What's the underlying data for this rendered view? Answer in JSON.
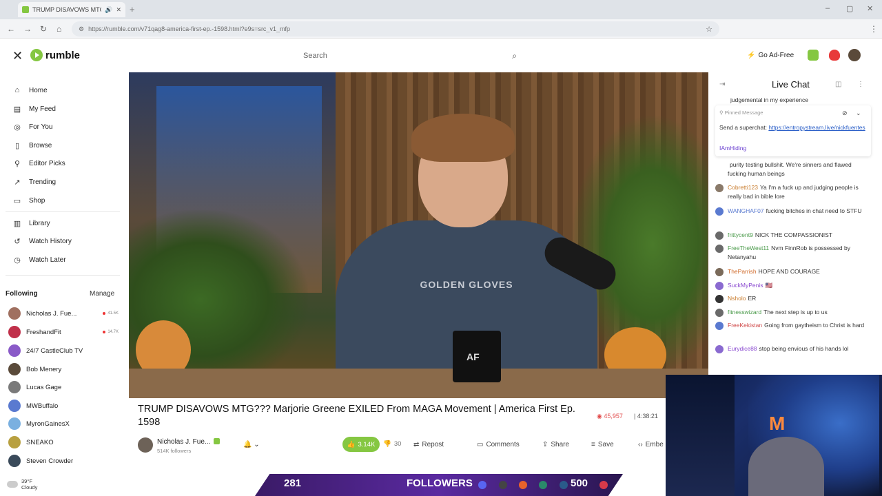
{
  "browser": {
    "tab_title": "TRUMP DISAVOWS MTG???",
    "url": "https://rumble.com/v71qag8-america-first-ep.-1598.html?e9s=src_v1_mfp",
    "profile_letter": "T"
  },
  "header": {
    "logo": "rumble",
    "search_placeholder": "Search",
    "go_ad_free": "Go Ad-Free"
  },
  "sidebar": {
    "items": [
      {
        "label": "Home",
        "icon": "home-icon"
      },
      {
        "label": "My Feed",
        "icon": "feed-icon"
      },
      {
        "label": "For You",
        "icon": "target-icon"
      },
      {
        "label": "Browse",
        "icon": "browse-icon"
      },
      {
        "label": "Editor Picks",
        "icon": "editor-picks-icon"
      },
      {
        "label": "Trending",
        "icon": "trending-icon"
      },
      {
        "label": "Shop",
        "icon": "shop-icon"
      },
      {
        "label": "Library",
        "icon": "library-icon"
      },
      {
        "label": "Watch History",
        "icon": "history-icon"
      },
      {
        "label": "Watch Later",
        "icon": "clock-icon"
      }
    ],
    "following_title": "Following",
    "manage": "Manage",
    "following": [
      {
        "name": "Nicholas J. Fue...",
        "live": "41.5K",
        "color": "#a07060"
      },
      {
        "name": "FreshandFit",
        "live": "14.7K",
        "color": "#c0304a"
      },
      {
        "name": "24/7 CastleClub TV",
        "live": "",
        "color": "#8a5ac8"
      },
      {
        "name": "Bob Menery",
        "live": "",
        "color": "#5a4a3a"
      },
      {
        "name": "Lucas Gage",
        "live": "",
        "color": "#7a7a7a"
      },
      {
        "name": "MWBuffalo",
        "live": "",
        "color": "#5a7ad0"
      },
      {
        "name": "MyronGainesX",
        "live": "",
        "color": "#7ab0e0"
      },
      {
        "name": "SNEAKO",
        "live": "",
        "color": "#b8a040"
      },
      {
        "name": "Steven Crowder",
        "live": "",
        "color": "#3a4a5a"
      }
    ]
  },
  "video": {
    "hoodie": "GOLDEN GLOVES",
    "mug": "AF",
    "title": "TRUMP DISAVOWS MTG??? Marjorie Greene EXILED From MAGA Movement | America First Ep. 1598",
    "views": "45,957",
    "duration": "| 4:38:21",
    "channel": "Nicholas J. Fue...",
    "followers": "514K followers",
    "likes": "3.14K",
    "dislikes": "30",
    "repost": "Repost",
    "comments": "Comments",
    "share": "Share",
    "save": "Save",
    "embed": "Embe"
  },
  "chat": {
    "title": "Live Chat",
    "cut_line": "judgemental in my experience",
    "pinned_label": "Pinned Message",
    "pinned_text": "Send a superchat: ",
    "pinned_link": "https://entropystream.live/nickfuentes",
    "pinned_user": "IAmHiding",
    "messages": [
      {
        "user": "",
        "text": "purity testing bullshit. We're sinners and flawed fucking human beings",
        "ucolor": "#333",
        "acolor": "#ffffff"
      },
      {
        "user": "Cobretti123",
        "text": "Ya I'm a fuck up and judging people is really bad in bible lore",
        "ucolor": "#c87a2a",
        "acolor": "#8a7a6a"
      },
      {
        "user": "WANGHAF07",
        "text": "fucking bitches in chat need to STFU",
        "ucolor": "#5a7ad0",
        "acolor": "#5a7ad0"
      },
      {
        "user": "frittycent9",
        "text": "NICK THE COMPASSIONIST",
        "ucolor": "#4a9a4a",
        "acolor": "#6a6a6a"
      },
      {
        "user": "FreeTheWest11",
        "text": "Nvm FinnRob is possessed by Netanyahu",
        "ucolor": "#4a9a4a",
        "acolor": "#6a6a6a"
      },
      {
        "user": "TheParrish",
        "text": "HOPE AND COURAGE",
        "ucolor": "#d06a2a",
        "acolor": "#7a6a5a"
      },
      {
        "user": "SuckMyPenis",
        "text": "🇺🇸",
        "ucolor": "#8a4ad0",
        "acolor": "#8a6ad0"
      },
      {
        "user": "Nsholo",
        "text": "ER",
        "ucolor": "#c87a2a",
        "acolor": "#333"
      },
      {
        "user": "fitnesswizard",
        "text": "The next step is up to us",
        "ucolor": "#4a9a4a",
        "acolor": "#6a6a6a"
      },
      {
        "user": "FreeKekistan",
        "text": "Going from gaytheism to Christ is hard",
        "ucolor": "#d04a4a",
        "acolor": "#5a7ad0"
      },
      {
        "user": "Eurydice88",
        "text": "stop being envious of his hands lol",
        "ucolor": "#8a4ad0",
        "acolor": "#8a6ad0"
      }
    ]
  },
  "overlay": {
    "count_left": "281",
    "label": "FOLLOWERS",
    "count_right": "500",
    "weather_temp": "39°F",
    "weather_desc": "Cloudy",
    "webcam_sign": "M"
  }
}
